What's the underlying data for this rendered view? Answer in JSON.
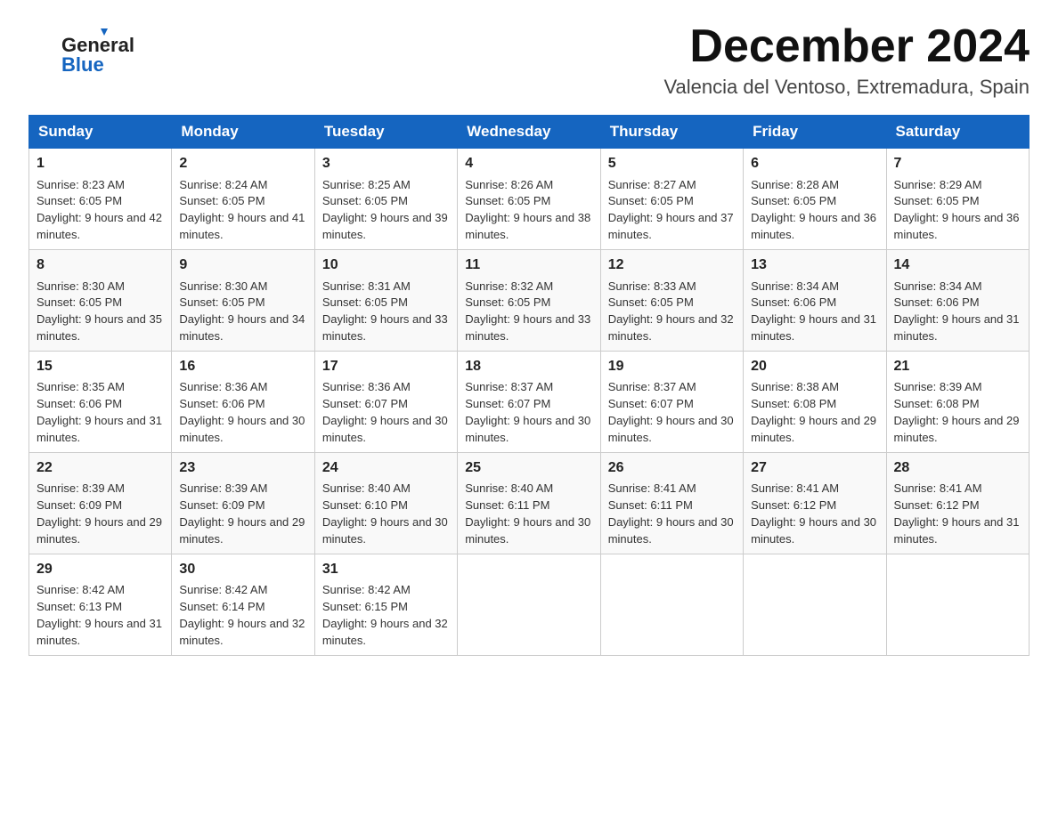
{
  "header": {
    "title": "December 2024",
    "subtitle": "Valencia del Ventoso, Extremadura, Spain",
    "logo_general": "General",
    "logo_blue": "Blue"
  },
  "columns": [
    "Sunday",
    "Monday",
    "Tuesday",
    "Wednesday",
    "Thursday",
    "Friday",
    "Saturday"
  ],
  "weeks": [
    [
      {
        "day": "1",
        "sunrise": "8:23 AM",
        "sunset": "6:05 PM",
        "daylight": "9 hours and 42 minutes."
      },
      {
        "day": "2",
        "sunrise": "8:24 AM",
        "sunset": "6:05 PM",
        "daylight": "9 hours and 41 minutes."
      },
      {
        "day": "3",
        "sunrise": "8:25 AM",
        "sunset": "6:05 PM",
        "daylight": "9 hours and 39 minutes."
      },
      {
        "day": "4",
        "sunrise": "8:26 AM",
        "sunset": "6:05 PM",
        "daylight": "9 hours and 38 minutes."
      },
      {
        "day": "5",
        "sunrise": "8:27 AM",
        "sunset": "6:05 PM",
        "daylight": "9 hours and 37 minutes."
      },
      {
        "day": "6",
        "sunrise": "8:28 AM",
        "sunset": "6:05 PM",
        "daylight": "9 hours and 36 minutes."
      },
      {
        "day": "7",
        "sunrise": "8:29 AM",
        "sunset": "6:05 PM",
        "daylight": "9 hours and 36 minutes."
      }
    ],
    [
      {
        "day": "8",
        "sunrise": "8:30 AM",
        "sunset": "6:05 PM",
        "daylight": "9 hours and 35 minutes."
      },
      {
        "day": "9",
        "sunrise": "8:30 AM",
        "sunset": "6:05 PM",
        "daylight": "9 hours and 34 minutes."
      },
      {
        "day": "10",
        "sunrise": "8:31 AM",
        "sunset": "6:05 PM",
        "daylight": "9 hours and 33 minutes."
      },
      {
        "day": "11",
        "sunrise": "8:32 AM",
        "sunset": "6:05 PM",
        "daylight": "9 hours and 33 minutes."
      },
      {
        "day": "12",
        "sunrise": "8:33 AM",
        "sunset": "6:05 PM",
        "daylight": "9 hours and 32 minutes."
      },
      {
        "day": "13",
        "sunrise": "8:34 AM",
        "sunset": "6:06 PM",
        "daylight": "9 hours and 31 minutes."
      },
      {
        "day": "14",
        "sunrise": "8:34 AM",
        "sunset": "6:06 PM",
        "daylight": "9 hours and 31 minutes."
      }
    ],
    [
      {
        "day": "15",
        "sunrise": "8:35 AM",
        "sunset": "6:06 PM",
        "daylight": "9 hours and 31 minutes."
      },
      {
        "day": "16",
        "sunrise": "8:36 AM",
        "sunset": "6:06 PM",
        "daylight": "9 hours and 30 minutes."
      },
      {
        "day": "17",
        "sunrise": "8:36 AM",
        "sunset": "6:07 PM",
        "daylight": "9 hours and 30 minutes."
      },
      {
        "day": "18",
        "sunrise": "8:37 AM",
        "sunset": "6:07 PM",
        "daylight": "9 hours and 30 minutes."
      },
      {
        "day": "19",
        "sunrise": "8:37 AM",
        "sunset": "6:07 PM",
        "daylight": "9 hours and 30 minutes."
      },
      {
        "day": "20",
        "sunrise": "8:38 AM",
        "sunset": "6:08 PM",
        "daylight": "9 hours and 29 minutes."
      },
      {
        "day": "21",
        "sunrise": "8:39 AM",
        "sunset": "6:08 PM",
        "daylight": "9 hours and 29 minutes."
      }
    ],
    [
      {
        "day": "22",
        "sunrise": "8:39 AM",
        "sunset": "6:09 PM",
        "daylight": "9 hours and 29 minutes."
      },
      {
        "day": "23",
        "sunrise": "8:39 AM",
        "sunset": "6:09 PM",
        "daylight": "9 hours and 29 minutes."
      },
      {
        "day": "24",
        "sunrise": "8:40 AM",
        "sunset": "6:10 PM",
        "daylight": "9 hours and 30 minutes."
      },
      {
        "day": "25",
        "sunrise": "8:40 AM",
        "sunset": "6:11 PM",
        "daylight": "9 hours and 30 minutes."
      },
      {
        "day": "26",
        "sunrise": "8:41 AM",
        "sunset": "6:11 PM",
        "daylight": "9 hours and 30 minutes."
      },
      {
        "day": "27",
        "sunrise": "8:41 AM",
        "sunset": "6:12 PM",
        "daylight": "9 hours and 30 minutes."
      },
      {
        "day": "28",
        "sunrise": "8:41 AM",
        "sunset": "6:12 PM",
        "daylight": "9 hours and 31 minutes."
      }
    ],
    [
      {
        "day": "29",
        "sunrise": "8:42 AM",
        "sunset": "6:13 PM",
        "daylight": "9 hours and 31 minutes."
      },
      {
        "day": "30",
        "sunrise": "8:42 AM",
        "sunset": "6:14 PM",
        "daylight": "9 hours and 32 minutes."
      },
      {
        "day": "31",
        "sunrise": "8:42 AM",
        "sunset": "6:15 PM",
        "daylight": "9 hours and 32 minutes."
      },
      null,
      null,
      null,
      null
    ]
  ]
}
